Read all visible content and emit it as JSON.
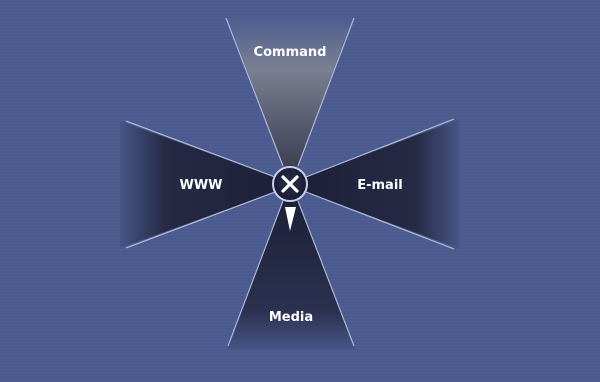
{
  "pie_menu": {
    "items": [
      {
        "id": "top",
        "label": "Command"
      },
      {
        "id": "left",
        "label": "WWW"
      },
      {
        "id": "right",
        "label": "E-mail"
      },
      {
        "id": "bottom",
        "label": "Media"
      }
    ],
    "center": {
      "icon": "close-icon",
      "pointer_icon": "pointer-arrow-icon"
    }
  },
  "colors": {
    "background": "#4b5b8f",
    "wedge_dark": "#1f2440",
    "wedge_top": "#787d8f",
    "edge_line": "#b6bfdc",
    "label": "#ffffff"
  }
}
